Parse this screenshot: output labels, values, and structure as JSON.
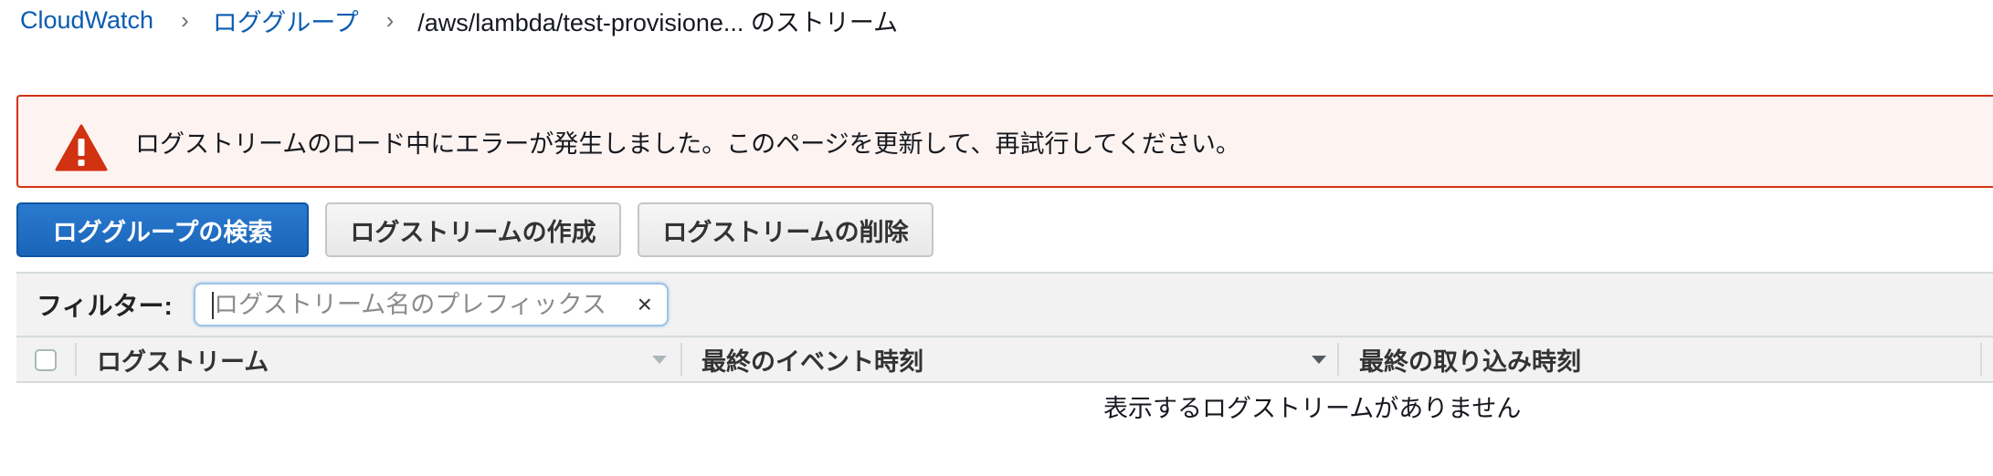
{
  "breadcrumb": {
    "items": [
      {
        "label": "CloudWatch"
      },
      {
        "label": "ロググループ"
      }
    ],
    "separator": "›",
    "current": "/aws/lambda/test-provisione... のストリーム"
  },
  "alert": {
    "icon": "warning-triangle-icon",
    "message": "ログストリームのロード中にエラーが発生しました。このページを更新して、再試行してください。",
    "color": "#d13212"
  },
  "toolbar": {
    "search_label": "ロググループの検索",
    "create_label": "ログストリームの作成",
    "delete_label": "ログストリームの削除"
  },
  "filter": {
    "label": "フィルター:",
    "value": "",
    "placeholder": "ログストリーム名のプレフィックス",
    "clear_glyph": "×"
  },
  "table": {
    "columns": [
      {
        "label": "ログストリーム"
      },
      {
        "label": "最終のイベント時刻"
      },
      {
        "label": "最終の取り込み時刻"
      }
    ],
    "empty_message": "表示するログストリームがありません"
  },
  "colors": {
    "link": "#0a5cb1",
    "primary_button": "#1f6fc5",
    "error": "#d13212"
  }
}
